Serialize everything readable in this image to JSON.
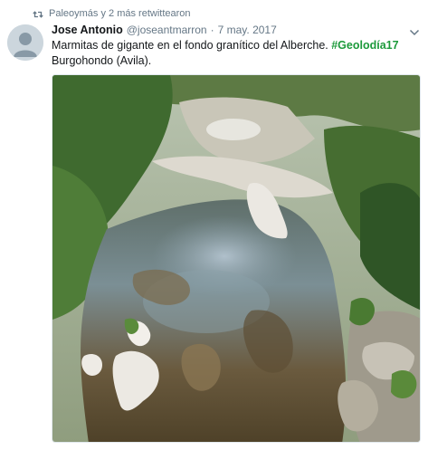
{
  "retweet": {
    "text": "Paleoymás y 2 más retwittearon",
    "icon": "retweet-icon"
  },
  "tweet": {
    "author_name": "Jose Antonio",
    "author_handle": "@joseantmarron",
    "separator": "·",
    "date": "7 may. 2017",
    "text_line1": "Marmitas de gigante en el fondo granítico del Alberche.",
    "hashtag": "#Geolodía17",
    "text_line2": "Burgohondo (Avila).",
    "hashtag_color": "#1c9a3b"
  },
  "media": {
    "alt": "photo"
  }
}
